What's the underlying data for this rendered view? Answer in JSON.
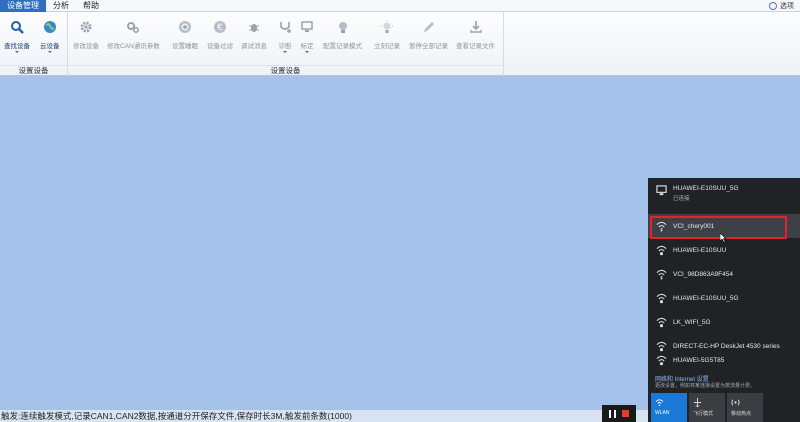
{
  "menubar": {
    "tabs": [
      "设备管理",
      "分析",
      "帮助"
    ],
    "options_label": "选项"
  },
  "ribbon": {
    "group_a": {
      "label": "设置设备",
      "buttons": [
        "查找设备",
        "云设备"
      ]
    },
    "group_b": {
      "label": "设置设备",
      "buttons": [
        "修改设备",
        "修改CAN通讯参数",
        "设置睡眠",
        "设备过滤",
        "调试消息",
        "诊断",
        "标定",
        "配置记录模式",
        "立刻记录",
        "暂停全部记录",
        "查看记录文件"
      ]
    }
  },
  "status": {
    "text": "触发:连续触发模式,记录CAN1,CAN2数据,按通道分开保存文件,保存时长3M,触发前条数(1000)"
  },
  "wifi": {
    "connected": {
      "ssid": "HUAWEI-E10SUU_5G",
      "state": "已连接"
    },
    "networks": [
      "VCI_chery001",
      "HUAWEI-E10SUU",
      "VCI_98D863A9F454",
      "HUAWEI-E10SUU_5G",
      "LK_WIFI_5G",
      "DIRECT-EC-HP DeskJet 4530 series",
      "HUAWEI-5G5T85"
    ],
    "settings_link": "网络和 Internet 设置",
    "settings_desc": "更改设置，例如将某连接设置为按流量计费。",
    "quick_actions": [
      "WLAN",
      "飞行模式",
      "移动热点"
    ]
  },
  "colors": {
    "workspace": "#a4c2ea",
    "accent": "#2f6fc2",
    "highlight": "#e2232b",
    "flyout_bg": "#202226"
  }
}
